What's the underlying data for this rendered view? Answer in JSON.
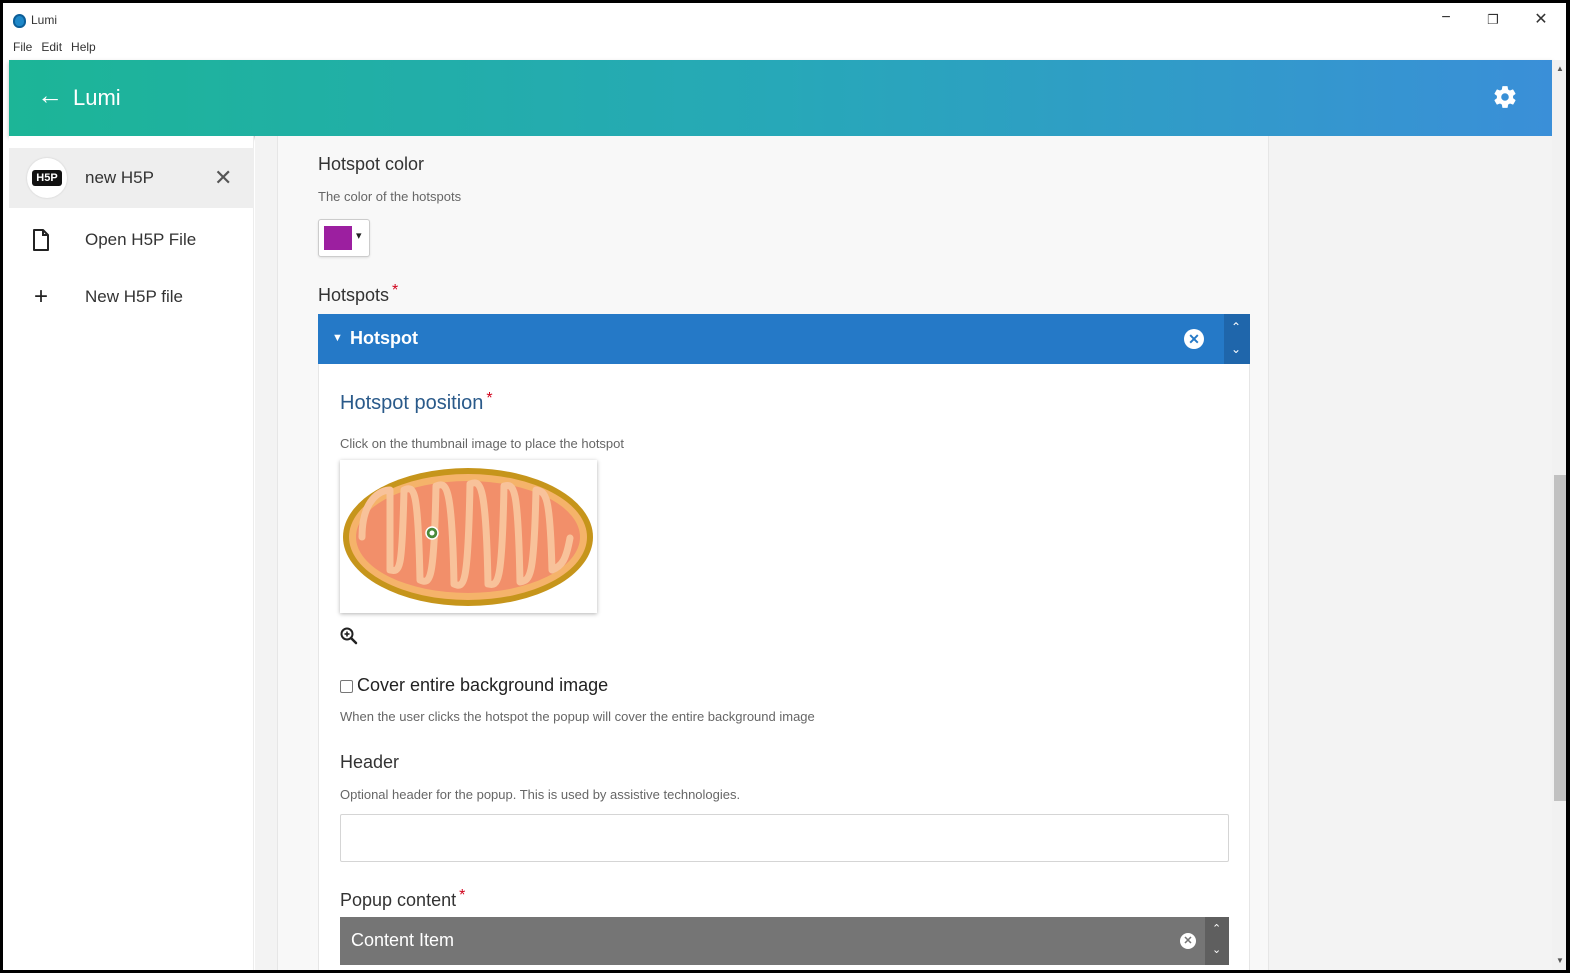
{
  "window": {
    "title": "Lumi",
    "controls": {
      "minimize": "−",
      "restore": "❐",
      "close": "✕"
    }
  },
  "menu": {
    "items": [
      "File",
      "Edit",
      "Help"
    ]
  },
  "appbar": {
    "back_icon": "←",
    "title": "Lumi",
    "settings_icon": "gear-icon"
  },
  "sidebar": {
    "items": [
      {
        "badge": "H5P",
        "label": "new H5P",
        "close": "✕",
        "active": true
      },
      {
        "icon": "file-icon",
        "label": "Open H5P File"
      },
      {
        "icon": "plus-icon",
        "glyph": "+",
        "label": "New H5P file"
      }
    ]
  },
  "editor": {
    "hotspot_color": {
      "label": "Hotspot color",
      "description": "The color of the hotspots",
      "value": "#9c1fa0",
      "caret": "▾"
    },
    "hotspots": {
      "label": "Hotspots",
      "required": "*",
      "group": {
        "collapse_icon": "▼",
        "title": "Hotspot",
        "remove_icon": "✕",
        "up_icon": "⌃",
        "down_icon": "⌄",
        "position": {
          "label": "Hotspot position",
          "required": "*",
          "description": "Click on the thumbnail image to place the hotspot"
        },
        "cover": {
          "label": "Cover entire background image",
          "description": "When the user clicks the hotspot the popup will cover the entire background image",
          "checked": false
        },
        "header": {
          "label": "Header",
          "description": "Optional header for the popup. This is used by assistive technologies.",
          "value": ""
        },
        "popup_content": {
          "label": "Popup content",
          "required": "*",
          "item_title": "Content Item",
          "remove_icon": "✕",
          "up_icon": "⌃",
          "down_icon": "⌄"
        }
      }
    }
  },
  "colors": {
    "appbar_start": "#1cb597",
    "appbar_end": "#3a8fd8",
    "group_bar": "#2579c7",
    "content_bar": "#757575",
    "required": "#d0021b"
  }
}
